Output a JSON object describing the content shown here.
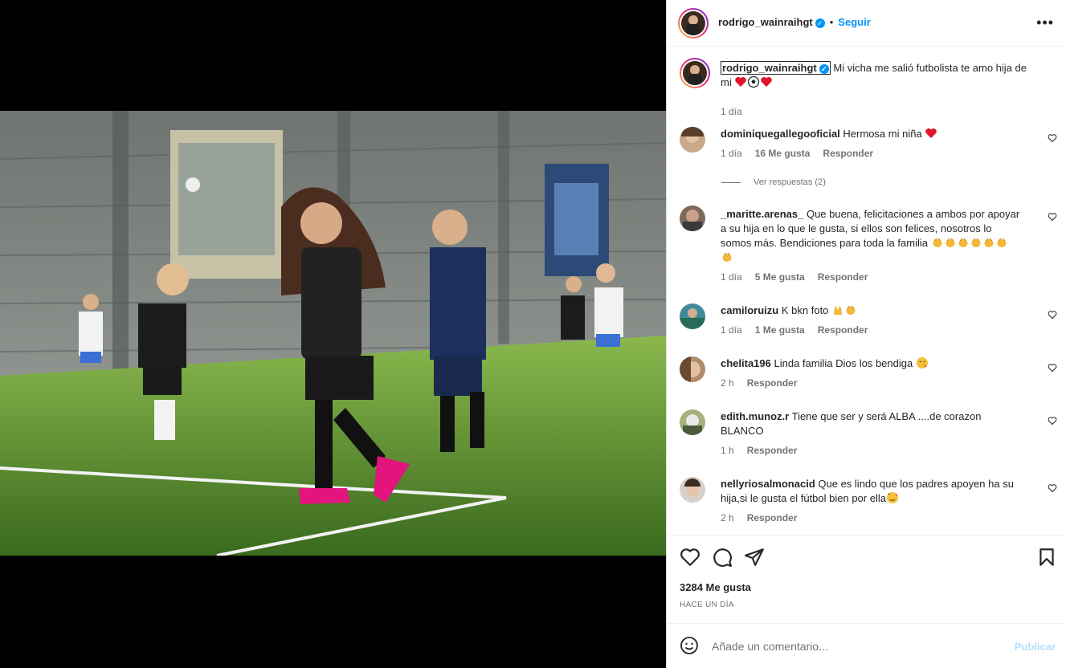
{
  "post": {
    "username": "rodrigo_wainraihgt",
    "follow_label": "Seguir",
    "more_label": "•••",
    "caption_text_line1": "Mi vicha me salió futbolista te amo hija de",
    "caption_text_line2": "mi",
    "caption_time": "1 día"
  },
  "comments": [
    {
      "user": "dominiquegallegooficial",
      "text": "Hermosa mi niña",
      "time": "1 día",
      "likes": "16 Me gusta",
      "reply": "Responder",
      "view_replies": "Ver respuestas (2)"
    },
    {
      "user": "_maritte.arenas_",
      "text_line1": "Que buena, felicitaciones a ambos por apoyar",
      "text_line2": "a su hija en lo que le gusta, si ellos son felices, nosotros lo",
      "text_line3": "somos más. Bendiciones para toda la familia",
      "time": "1 día",
      "likes": "5 Me gusta",
      "reply": "Responder"
    },
    {
      "user": "camiloruizu",
      "text": "K bkn foto",
      "time": "1 día",
      "likes": "1 Me gusta",
      "reply": "Responder"
    },
    {
      "user": "chelita196",
      "text": "Linda familia Dios los bendiga",
      "time": "2 h",
      "reply": "Responder"
    },
    {
      "user": "edith.munoz.r",
      "text_line1": "Tiene que ser y será ALBA ....de corazon",
      "text_line2": "BLANCO",
      "time": "1 h",
      "reply": "Responder"
    },
    {
      "user": "nellyriosalmonacid",
      "text_line1": "Que es lindo que los padres apoyen ha su",
      "text_line2": "hija,si le gusta el fútbol bien por ella",
      "time": "2 h",
      "reply": "Responder"
    }
  ],
  "stats": {
    "likes": "3284 Me gusta",
    "date": "HACE UN DÍA"
  },
  "add_comment": {
    "placeholder": "Añade un comentario...",
    "publish": "Publicar"
  },
  "icons": {
    "like": "heart-icon",
    "comment": "comment-icon",
    "share": "send-icon",
    "save": "bookmark-icon",
    "emoji": "emoji-icon"
  },
  "colors": {
    "accent": "#0095f6",
    "publish_disabled": "#b2dffc",
    "heart_red": "#ed4956"
  }
}
